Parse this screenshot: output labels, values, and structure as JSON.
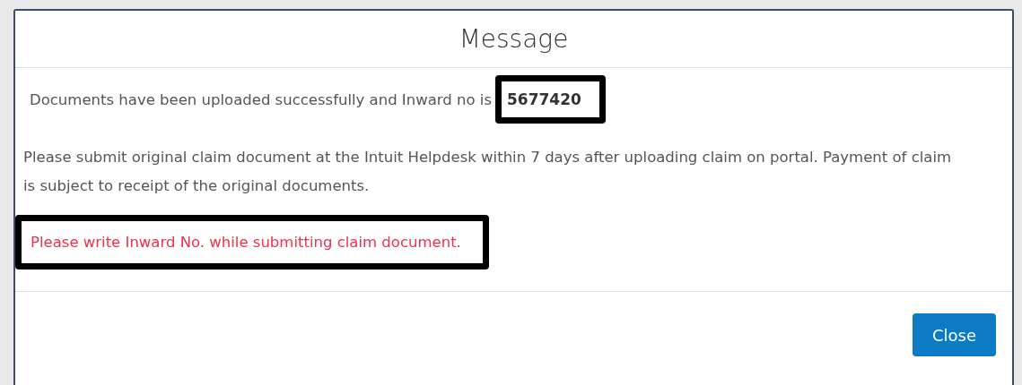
{
  "dialog": {
    "title": "Message",
    "messages": [
      {
        "kind": "inward",
        "text": "Documents have been uploaded successfully and Inward no is",
        "value": "5677420",
        "highlighted": true
      },
      {
        "kind": "plain",
        "text": "Please submit original claim document at the Intuit Helpdesk within 7 days after uploading claim on portal. Payment of claim is subject to receipt of the original documents.",
        "highlighted": false
      },
      {
        "kind": "alert",
        "text": "Please write Inward No. while submitting claim document.",
        "highlighted": true
      }
    ],
    "buttons": [
      {
        "label": "Close"
      }
    ]
  }
}
